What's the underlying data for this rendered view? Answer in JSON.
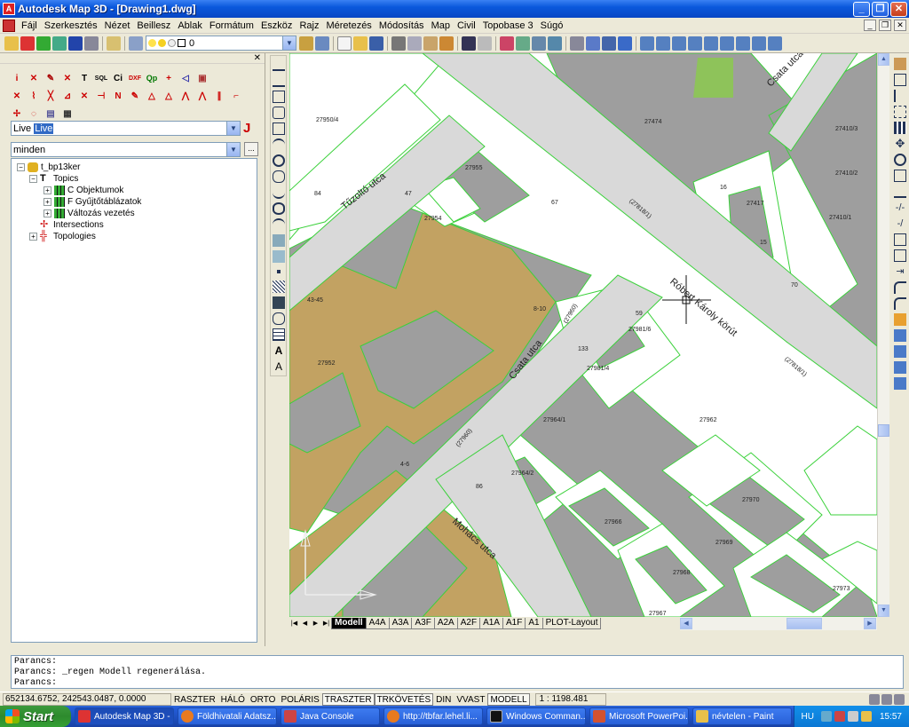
{
  "window": {
    "title": "Autodesk Map 3D - [Drawing1.dwg]",
    "app_icon_glyph": "A"
  },
  "menu": {
    "items": [
      "Fájl",
      "Szerkesztés",
      "Nézet",
      "Beillesz",
      "Ablak",
      "Formátum",
      "Eszköz",
      "Rajz",
      "Méretezés",
      "Módosítás",
      "Map",
      "Civil",
      "Topobase 3",
      "Súgó"
    ]
  },
  "toolbar": {
    "layer_value": "0"
  },
  "left_panel": {
    "icon_row1": [
      "i",
      "✕",
      "✎",
      "✕",
      "T",
      "SQL",
      "Ci",
      "DXF",
      "Qp",
      "+",
      "◁",
      "▣"
    ],
    "icon_row2": [
      "✕",
      "⌇",
      "╳",
      "⊿",
      "✕",
      "⊣",
      "N",
      "✎",
      "△",
      "△",
      "⋀",
      "⋀",
      "∥",
      "⌐"
    ],
    "icon_row3": [
      "✢",
      "◌",
      "▤",
      "▦"
    ],
    "live_label": "Live",
    "live_value": "Live",
    "filter_value": "minden",
    "tree": {
      "root": "t_bp13ker",
      "topics": "Topics",
      "objektumok": "C Objektumok",
      "gyujto": "F Gyűjtőtáblázatok",
      "valtozas": "Változás vezetés",
      "intersections": "Intersections",
      "topologies": "Topologies"
    }
  },
  "map": {
    "streets": {
      "tuzolto": "Tűzoltó utca",
      "csata1": "Csata utca",
      "csata2": "Csata utca",
      "robert": "Róbert Károly körút",
      "mohacs": "Mohács utca"
    },
    "parcels": [
      "27950/4",
      "27474",
      "27410/3",
      "27410/2",
      "27410/1",
      "27417",
      "27955",
      "27954",
      "27981/6",
      "27981/4",
      "27962",
      "27964/1",
      "27964/2",
      "27952",
      "27966",
      "27969",
      "27968",
      "27973",
      "27967",
      "27970"
    ],
    "ids": [
      "(27818/1)",
      "(27960)",
      "(27818/1)",
      "(27960)"
    ],
    "housenos": [
      "84",
      "47",
      "67",
      "70",
      "16",
      "15",
      "59",
      "133",
      "86",
      "8-10",
      "4-6",
      "43-45"
    ]
  },
  "layout_tabs": [
    "Modell",
    "A4A",
    "A3A",
    "A3F",
    "A2A",
    "A2F",
    "A1A",
    "A1F",
    "A1",
    "PLOT-Layout"
  ],
  "command": {
    "line1": "Parancs:",
    "line2": "Parancs: _regen Modell regenerálása.",
    "line3": "Parancs:"
  },
  "status": {
    "coords": "652134.6752, 242543.0487, 0.0000",
    "buttons": [
      "RASZTER",
      "HÁLÓ",
      "ORTO",
      "POLÁRIS",
      "TRASZTER",
      "TRKÖVETÉS",
      "DIN",
      "VVAST",
      "MODELL"
    ],
    "scale": "1 : 1198.481"
  },
  "taskbar": {
    "start": "Start",
    "tasks": [
      "Autodesk Map 3D - ...",
      "Földhivatali Adatsz...",
      "Java Console",
      "http://tbfar.lehel.li...",
      "Windows Comman...",
      "Microsoft PowerPoi...",
      "névtelen - Paint"
    ],
    "lang": "HU",
    "time": "15:57"
  }
}
